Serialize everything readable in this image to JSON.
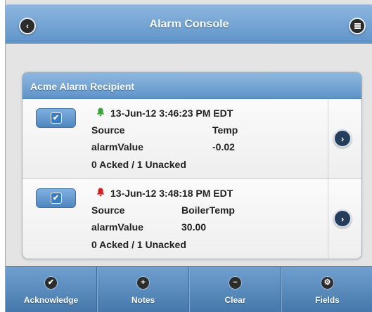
{
  "header": {
    "title": "Alarm Console",
    "back_icon": "back-arrow-icon",
    "menu_icon": "menu-icon"
  },
  "panel": {
    "title": "Acme Alarm Recipient",
    "alarms": [
      {
        "bell_color": "#3aa53a",
        "timestamp": "13-Jun-12 3:46:23 PM EDT",
        "source_label": "Source",
        "source_value": "Temp",
        "value_label": "alarmValue",
        "value_value": "-0.02",
        "ack_status": "0 Acked / 1 Unacked"
      },
      {
        "bell_color": "#d42020",
        "timestamp": "13-Jun-12 3:48:18 PM EDT",
        "source_label": "Source",
        "source_value": "BoilerTemp",
        "value_label": "alarmValue",
        "value_value": "30.00",
        "ack_status": "0 Acked / 1 Unacked"
      }
    ]
  },
  "footer": {
    "items": [
      {
        "label": "Acknowledge",
        "icon": "check-icon",
        "glyph": "✔"
      },
      {
        "label": "Notes",
        "icon": "plus-icon",
        "glyph": "+"
      },
      {
        "label": "Clear",
        "icon": "minus-icon",
        "glyph": "−"
      },
      {
        "label": "Fields",
        "icon": "gear-icon",
        "glyph": "⚙"
      }
    ]
  },
  "colors": {
    "accent": "#5f94c9",
    "background": "#e4e4e4"
  }
}
